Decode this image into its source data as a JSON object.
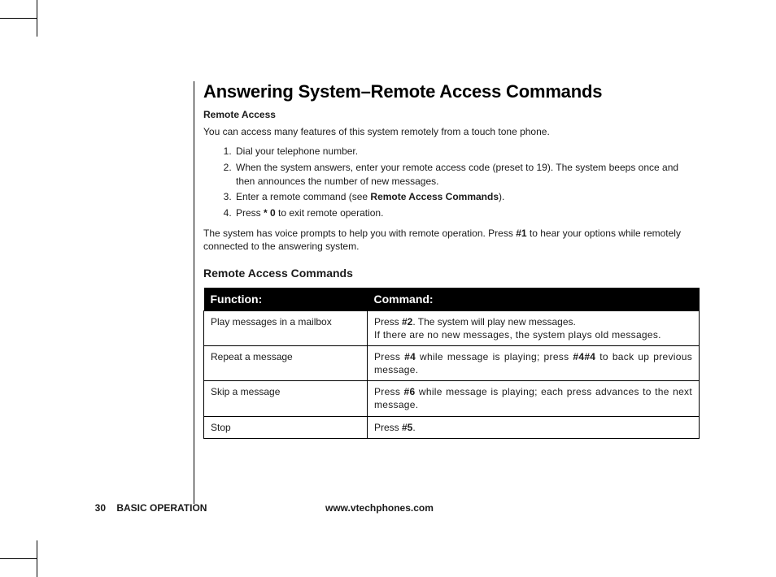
{
  "title": "Answering System–Remote Access Commands",
  "subheading": "Remote Access",
  "intro": "You can access many features of this system remotely from a touch tone phone.",
  "steps": {
    "s1": "Dial your telephone number.",
    "s2": "When the system answers, enter your remote access code (preset to 19). The system beeps once and then announces the number of new messages.",
    "s3_a": "Enter a remote command (see ",
    "s3_b": "Remote Access Commands",
    "s3_c": ").",
    "s4_a": "Press ",
    "s4_b": "* 0",
    "s4_c": "  to exit remote operation."
  },
  "after_a": "The system has voice prompts to help you with remote operation. Press ",
  "after_b": "#1",
  "after_c": " to hear your options while remotely connected to the answering system.",
  "cmd_heading": "Remote Access Commands",
  "table": {
    "h1": "Function:",
    "h2": "Command:",
    "rows": {
      "r0": {
        "func": "Play messages in a mailbox",
        "c_a": "Press ",
        "c_b": "#2",
        "c_c": ". The system will play new messages.",
        "c_d": "If there are no new messages, the system plays old messages."
      },
      "r1": {
        "func": "Repeat a message",
        "c_a": "Press ",
        "c_b": "#4",
        "c_c": " while message is playing; press ",
        "c_d": "#4#4",
        "c_e": " to back up previous message."
      },
      "r2": {
        "func": "Skip a message",
        "c_a": "Press ",
        "c_b": "#6",
        "c_c": " while message is playing; each press advances to the next message."
      },
      "r3": {
        "func": "Stop",
        "c_a": "Press ",
        "c_b": "#5",
        "c_c": "."
      }
    }
  },
  "footer": {
    "page": "30",
    "section": "BASIC OPERATION",
    "url": "www.vtechphones.com"
  }
}
